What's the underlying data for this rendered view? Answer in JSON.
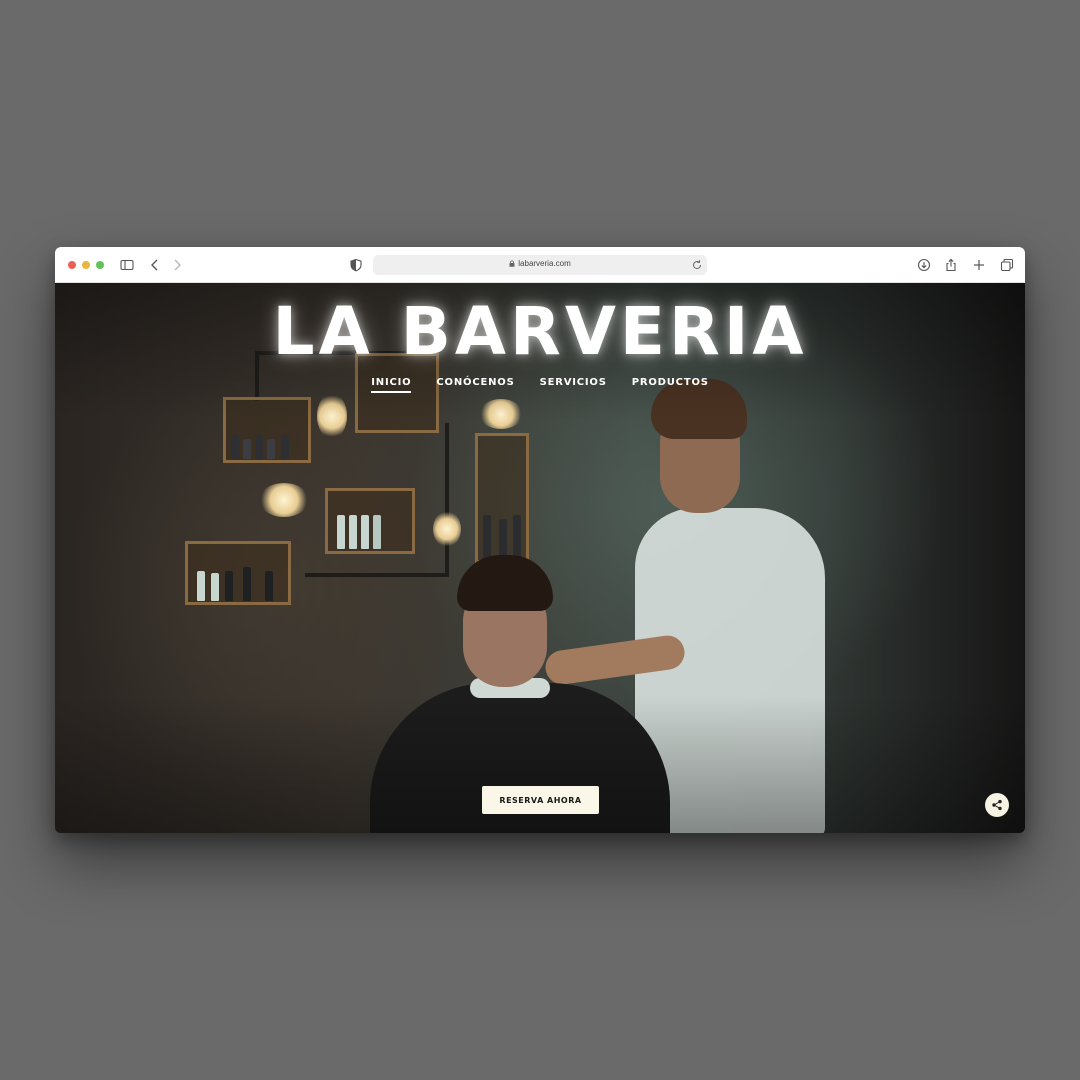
{
  "browser": {
    "url": "labarveria.com",
    "icons": {
      "sidebar": "sidebar-icon",
      "back": "chevron-left-icon",
      "forward": "chevron-right-icon",
      "privacy": "shield-icon",
      "lock": "lock-icon",
      "reload": "reload-icon",
      "downloads": "download-icon",
      "share": "share-icon",
      "new_tab": "plus-icon",
      "tabs": "tabs-overview-icon"
    },
    "colors": {
      "close": "#ec5f57",
      "minimize": "#e8b53f",
      "zoom": "#5fc454"
    }
  },
  "site": {
    "logo": "LA BARVERIA",
    "nav": [
      {
        "label": "INICIO",
        "active": true
      },
      {
        "label": "CONÓCENOS",
        "active": false
      },
      {
        "label": "SERVICIOS",
        "active": false
      },
      {
        "label": "PRODUCTOS",
        "active": false
      }
    ],
    "cta_label": "RESERVA AHORA",
    "share_icon": "share-icon",
    "colors": {
      "cta_bg": "#fbf7e8",
      "text": "#ffffff"
    }
  }
}
